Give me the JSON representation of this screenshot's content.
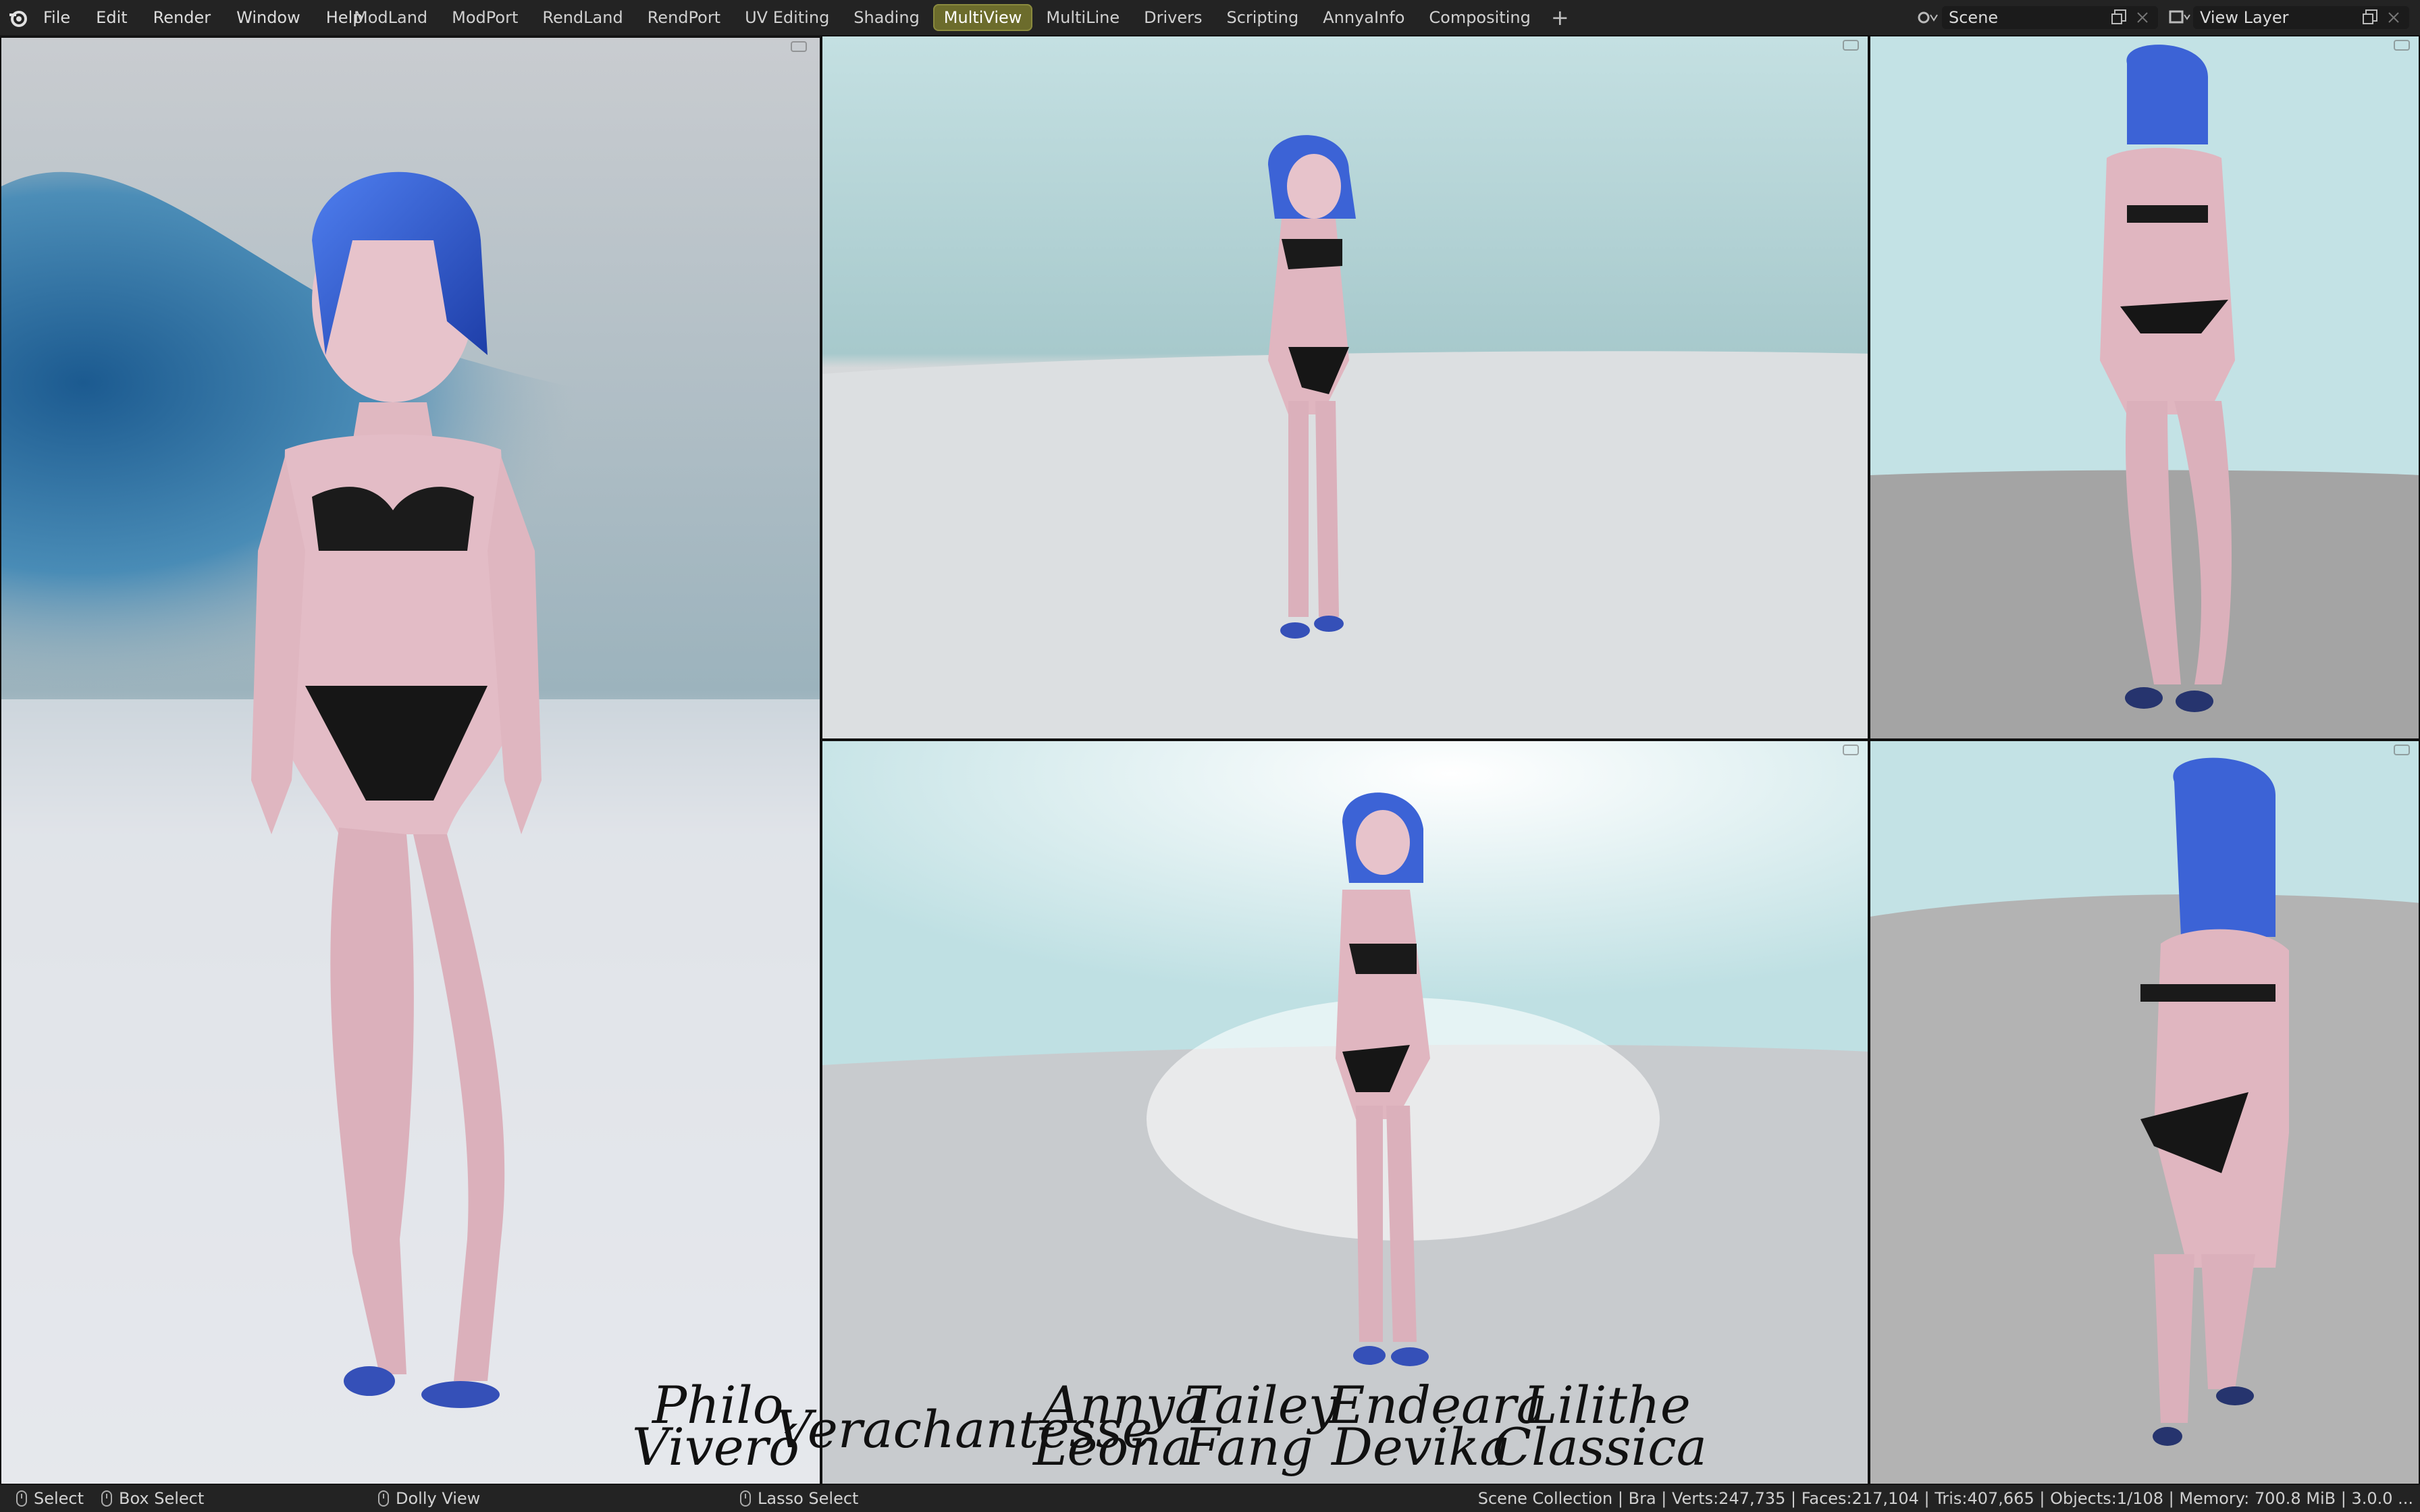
{
  "menu": {
    "items": [
      "File",
      "Edit",
      "Render",
      "Window",
      "Help"
    ]
  },
  "workspaces": {
    "tabs": [
      "ModLand",
      "ModPort",
      "RendLand",
      "RendPort",
      "UV Editing",
      "Shading",
      "MultiView",
      "MultiLine",
      "Drivers",
      "Scripting",
      "AnnyaInfo",
      "Compositing"
    ],
    "active": "MultiView",
    "add_label": "+"
  },
  "scene": {
    "label": "Scene"
  },
  "view_layer": {
    "label": "View Layer"
  },
  "status": {
    "select": "Select",
    "box_select": "Box Select",
    "dolly_view": "Dolly View",
    "lasso_select": "Lasso Select",
    "stats": "Scene Collection | Bra | Verts:247,735 | Faces:217,104 | Tris:407,665 | Objects:1/108 | Memory: 700.8 MiB | 3.0.0 ..."
  },
  "signatures": {
    "philo": "Philo",
    "vivero": "Viveró",
    "verachantesse": "Verachantesse",
    "annya": "Annya",
    "leona": "Leona",
    "tailey": "Tailey",
    "fang": "Fang",
    "endeara": "Endeara",
    "devika": "Devika",
    "lilithe": "Lilithe",
    "classica": "Classica"
  },
  "colors": {
    "accent": "#6c6c2c",
    "topbar": "#232323",
    "hair": "#3a62d8",
    "skin": "#e6bcc6",
    "bikini": "#1a1a1a"
  },
  "icons": [
    "blender-logo-icon",
    "scene-icon",
    "copy-icon",
    "close-icon",
    "view-layer-icon",
    "mouse-icon"
  ]
}
